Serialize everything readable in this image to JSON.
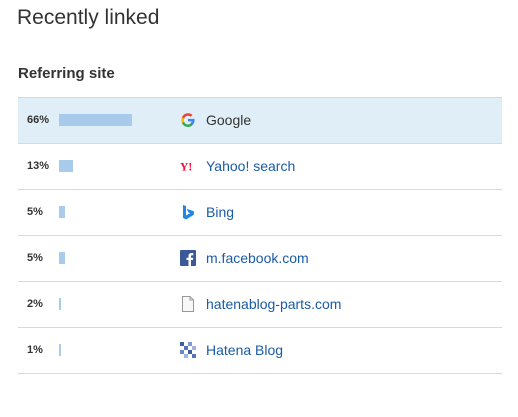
{
  "page": {
    "title": "Recently linked",
    "section_heading": "Referring site"
  },
  "referrers": [
    {
      "percent_label": "66%",
      "percent": 66,
      "site": "Google",
      "icon": "google-icon",
      "highlighted": true
    },
    {
      "percent_label": "13%",
      "percent": 13,
      "site": "Yahoo! search",
      "icon": "yahoo-icon",
      "highlighted": false
    },
    {
      "percent_label": "5%",
      "percent": 5,
      "site": "Bing",
      "icon": "bing-icon",
      "highlighted": false
    },
    {
      "percent_label": "5%",
      "percent": 5,
      "site": "m.facebook.com",
      "icon": "facebook-icon",
      "highlighted": false
    },
    {
      "percent_label": "2%",
      "percent": 2,
      "site": "hatenablog-parts.com",
      "icon": "page-icon",
      "highlighted": false
    },
    {
      "percent_label": "1%",
      "percent": 1,
      "site": "Hatena Blog",
      "icon": "hatena-blog-icon",
      "highlighted": false
    }
  ],
  "colors": {
    "bar": "#a9cbeb",
    "row_highlight": "#e0eef7",
    "link": "#1a5ba6"
  }
}
